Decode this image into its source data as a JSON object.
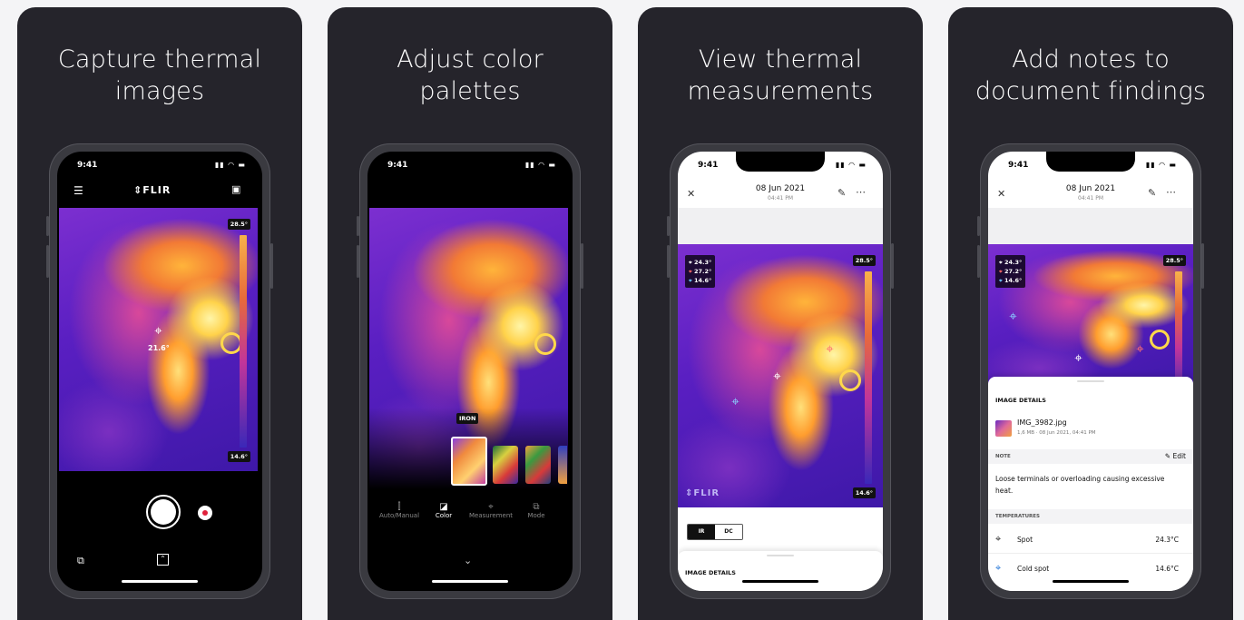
{
  "panels": [
    {
      "headline": [
        "Capture thermal",
        "images"
      ],
      "status": {
        "time": "9:41",
        "icons": "▮▮ ◠ ▬"
      },
      "brand": "FLIR",
      "spot_temp": "21.6°",
      "scale_max": "28.5°",
      "scale_min": "14.6°"
    },
    {
      "headline": [
        "Adjust color",
        "palettes"
      ],
      "status": {
        "time": "9:41",
        "icons": "▮▮ ◠ ▬"
      },
      "palette_label": "IRON",
      "tools": [
        {
          "label": "Auto/Manual",
          "icon": "slider-icon"
        },
        {
          "label": "Color",
          "icon": "palette-icon"
        },
        {
          "label": "Measurement",
          "icon": "crosshair-icon"
        },
        {
          "label": "Mode",
          "icon": "layers-icon"
        }
      ]
    },
    {
      "headline": [
        "View thermal",
        "measurements"
      ],
      "status": {
        "time": "9:41",
        "icons": "▮▮ ◠ ▬"
      },
      "date": "08 Jun 2021",
      "time_sub": "04:41 PM",
      "readings": [
        "24.3°",
        "27.2°",
        "14.6°"
      ],
      "scale_max": "28.5°",
      "scale_min": "14.6°",
      "brand": "FLIR",
      "modes": [
        "IR",
        "DC"
      ],
      "section": "IMAGE DETAILS"
    },
    {
      "headline": [
        "Add notes to",
        "document findings"
      ],
      "status": {
        "time": "9:41",
        "icons": "▮▮ ◠ ▬"
      },
      "date": "08 Jun 2021",
      "time_sub": "04:41 PM",
      "readings": [
        "24.3°",
        "27.2°",
        "14.6°"
      ],
      "scale_max": "28.5°",
      "section": "IMAGE DETAILS",
      "file_name": "IMG_3982.jpg",
      "file_meta": "1,6 MB · 08 Jun 2021, 04:41 PM",
      "note_label": "NOTE",
      "edit_label": "Edit",
      "note_text": "Loose terminals or overloading causing excessive heat.",
      "temps_label": "TEMPERATURES",
      "temps": [
        {
          "name": "Spot",
          "value": "24.3°C"
        },
        {
          "name": "Cold spot",
          "value": "14.6°C"
        }
      ]
    }
  ]
}
